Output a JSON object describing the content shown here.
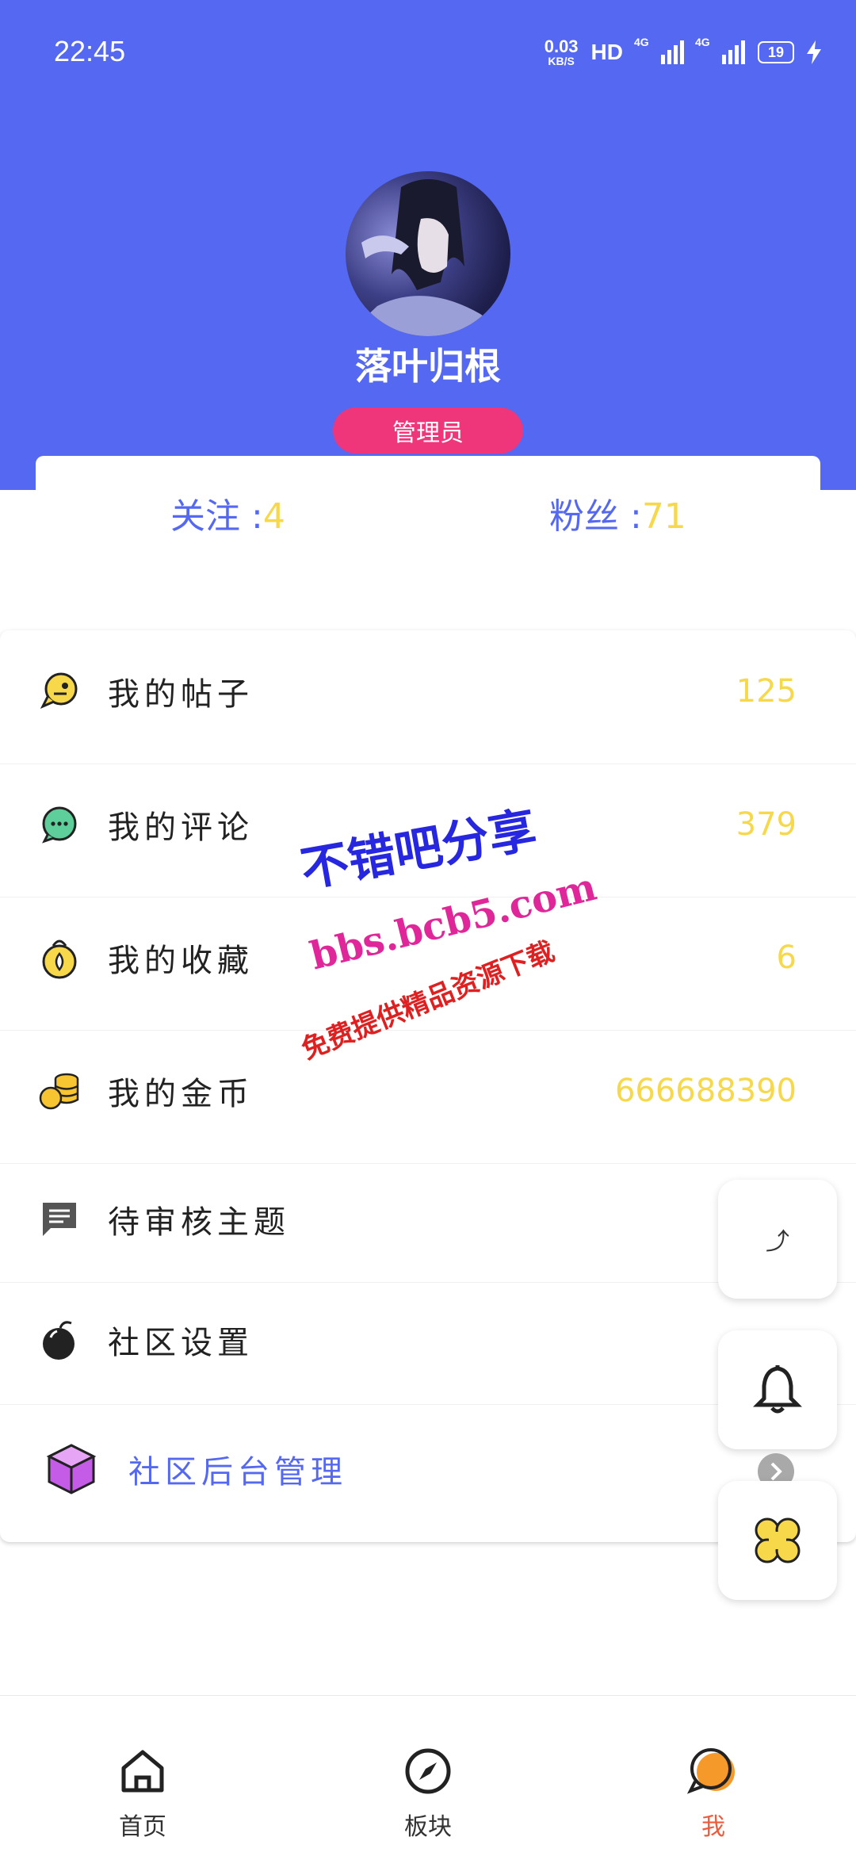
{
  "status_bar": {
    "time": "22:45",
    "net_speed_value": "0.03",
    "net_speed_unit": "KB/S",
    "hd_label": "HD",
    "signal1_label": "4G",
    "signal2_label": "4G",
    "battery": "19"
  },
  "profile": {
    "username": "落叶归根",
    "role": "管理员",
    "follow_label": "关注 :",
    "follow_count": "4",
    "fans_label": "粉丝 :",
    "fans_count": "71"
  },
  "menu": [
    {
      "label": "我的帖子",
      "value": "125",
      "icon": "chat-bubble-icon"
    },
    {
      "label": "我的评论",
      "value": "379",
      "icon": "comment-icon"
    },
    {
      "label": "我的收藏",
      "value": "6",
      "icon": "collection-icon"
    },
    {
      "label": "我的金币",
      "value": "666688390",
      "icon": "coin-stack-icon"
    },
    {
      "label": "待审核主题",
      "value": "",
      "icon": "message-icon"
    },
    {
      "label": "社区设置",
      "value": "",
      "icon": "bomb-icon"
    },
    {
      "label": "社区后台管理",
      "value": "",
      "icon": "cube-icon"
    }
  ],
  "fab": {
    "share_glyph": "⤴"
  },
  "watermark": {
    "line1": "不错吧分享",
    "line2": "bbs.bcb5.com",
    "line3": "免费提供精品资源下载"
  },
  "bottom_nav": [
    {
      "label": "首页",
      "icon": "home-icon"
    },
    {
      "label": "板块",
      "icon": "compass-icon"
    },
    {
      "label": "我",
      "icon": "profile-bubble-icon",
      "active": true
    }
  ],
  "colors": {
    "header_bg": "#5468f2",
    "role_badge": "#f0367a",
    "value_yellow": "#f7d84a",
    "active_nav": "#f05a3a"
  }
}
